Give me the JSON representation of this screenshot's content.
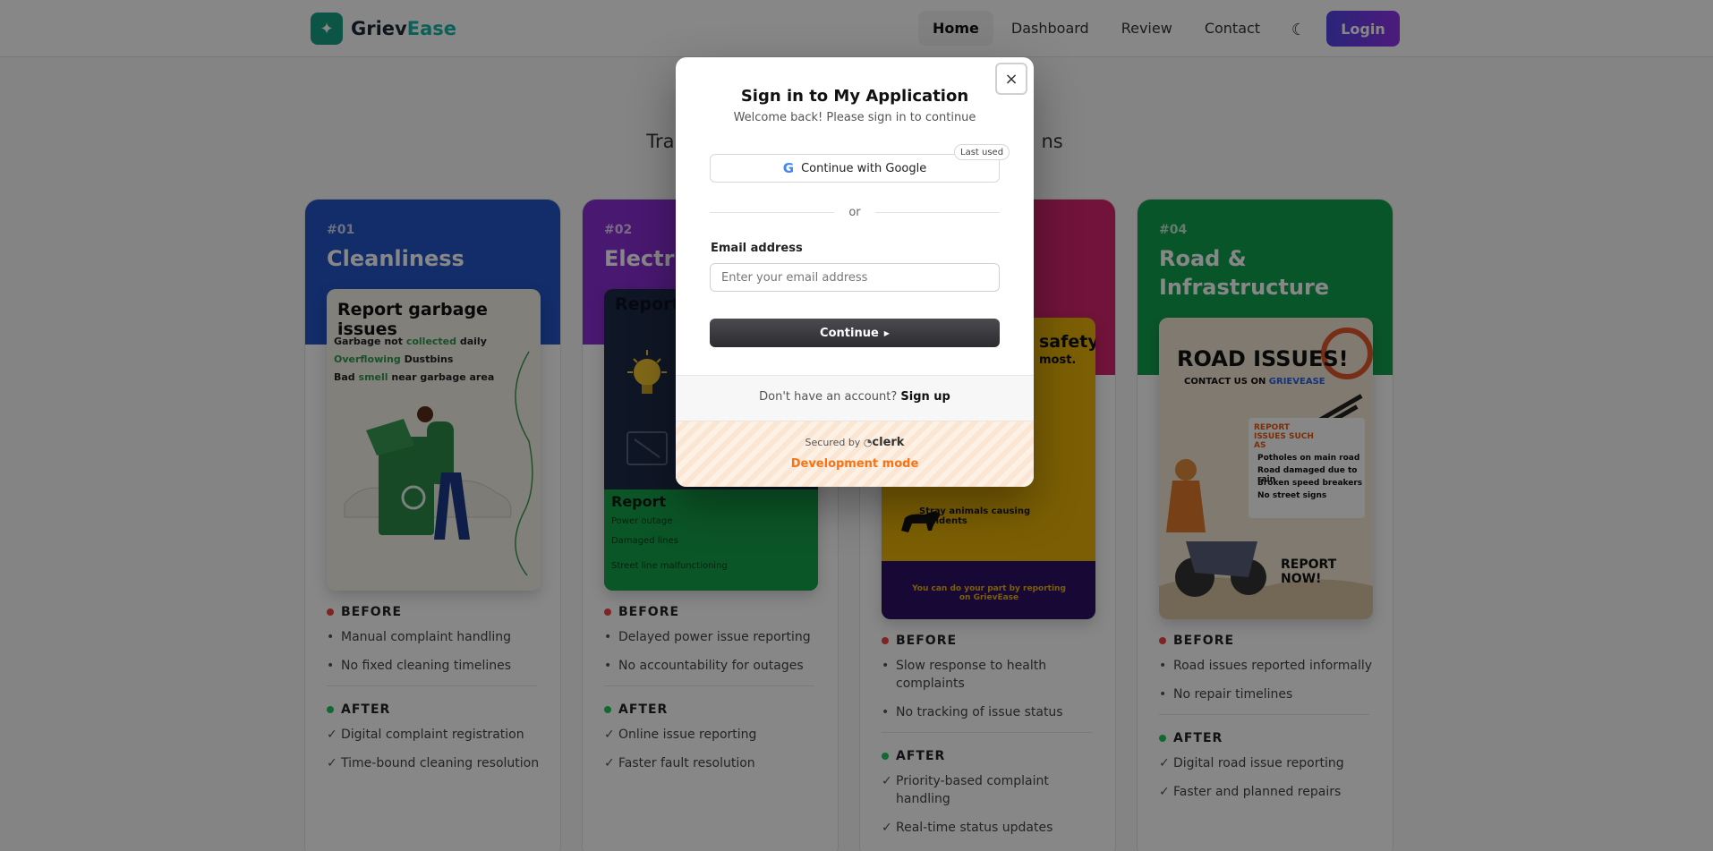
{
  "header": {
    "brand_part1": "Griev",
    "brand_part2": "Ease",
    "nav": [
      "Home",
      "Dashboard",
      "Review",
      "Contact"
    ],
    "login_label": "Login"
  },
  "hero": {
    "subtitle_left": "Tra",
    "subtitle_right": "ns"
  },
  "cards": [
    {
      "number": "#01",
      "title": "Cleanliness",
      "color": "#2455c9",
      "poster": {
        "heading": "Report garbage issues",
        "lines": [
          {
            "pre": "Garbage not ",
            "hl": "collected",
            "post": " daily"
          },
          {
            "pre": "",
            "hl": "Overflowing",
            "post": " Dustbins"
          },
          {
            "pre": "Bad ",
            "hl": "smell",
            "post": " near garbage area"
          }
        ]
      },
      "before_label": "BEFORE",
      "before": [
        "Manual complaint handling",
        "No fixed cleaning timelines"
      ],
      "after_label": "AFTER",
      "after": [
        "Digital complaint registration",
        "Time-bound cleaning resolution"
      ]
    },
    {
      "number": "#02",
      "title": "Electric",
      "color": "#8b2fd6",
      "poster": {
        "heading": "Report",
        "green_heading": "Report",
        "lines": [
          "Power outage",
          "Damaged lines",
          "Street line malfunctioning"
        ]
      },
      "before_label": "BEFORE",
      "before": [
        "Delayed power issue reporting",
        "No accountability for outages"
      ],
      "after_label": "AFTER",
      "after": [
        "Online issue reporting",
        "Faster fault resolution"
      ]
    },
    {
      "number": "",
      "title": "",
      "color": "#d6246e",
      "poster": {
        "heading": "safety",
        "subheading": "most.",
        "stray": "Stray animals causing accidents",
        "bottom": "You can do your part by reporting on GrievEase"
      },
      "before_label": "BEFORE",
      "before": [
        "Slow response to health complaints",
        "No tracking of issue status"
      ],
      "after_label": "AFTER",
      "after": [
        "Priority-based complaint handling",
        "Real-time status updates"
      ]
    },
    {
      "number": "#04",
      "title": "Road & Infrastructure",
      "color": "#12a150",
      "poster": {
        "heading": "ROAD ISSUES!",
        "contact_pre": "CONTACT US ON ",
        "contact_brand": "GRIEVEASE",
        "box_heading": "REPORT ISSUES SUCH AS",
        "box_items": [
          "Potholes on main road",
          "Road damaged due to rain",
          "Broken speed breakers",
          "No street signs"
        ],
        "cta": "REPORT NOW!"
      },
      "before_label": "BEFORE",
      "before": [
        "Road issues reported informally",
        "No repair timelines"
      ],
      "after_label": "AFTER",
      "after": [
        "Digital road issue reporting",
        "Faster and planned repairs"
      ]
    }
  ],
  "modal": {
    "close_symbol": "×",
    "title": "Sign in to My Application",
    "subtitle": "Welcome back! Please sign in to continue",
    "google_label": "Continue with Google",
    "google_glyph": "G",
    "last_used": "Last used",
    "or": "or",
    "email_label": "Email address",
    "email_placeholder": "Enter your email address",
    "email_value": "",
    "continue_label": "Continue",
    "no_account": "Don't have an account?",
    "signup_label": "Sign up",
    "secured_by": "Secured by",
    "clerk": "clerk",
    "dev_mode": "Development mode"
  },
  "colors": {
    "accent": "#14b8a6",
    "login_gradient_start": "#4f46e5",
    "login_gradient_end": "#9333ea",
    "dev_mode": "#f97316"
  },
  "icons": {
    "logo": "sparkle-icon",
    "theme": "moon-icon",
    "close": "close-icon",
    "google": "google-icon",
    "continue": "triangle-right-icon"
  }
}
